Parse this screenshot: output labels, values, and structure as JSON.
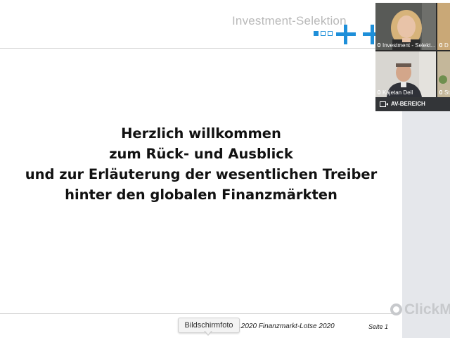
{
  "slide": {
    "brand": "Investment-Selektion",
    "welcome_lines": [
      "Herzlich willkommen",
      "zum Rück- und Ausblick",
      "und zur Erläuterung der wesentlichen Treiber",
      "hinter den globalen Finanzmärkten"
    ],
    "footer": ".2020  Finanzmarkt-Lotse 2020",
    "page": "Seite 1"
  },
  "tooltip": "Bildschirmfoto",
  "watermark": "ClickM",
  "video": {
    "tiles": [
      {
        "label": "Investment - Selekt...",
        "icon": "microphone-icon"
      },
      {
        "label": "D",
        "icon": "microphone-icon"
      },
      {
        "label": "Kajetan Deil",
        "icon": "microphone-icon"
      },
      {
        "label": "St",
        "icon": "microphone-icon"
      }
    ],
    "av_label": "AV-BEREICH",
    "av_icon": "camera-icon"
  },
  "colors": {
    "accent": "#1e8fd9",
    "panel": "#e5e7eb",
    "video_bar": "#333538"
  }
}
